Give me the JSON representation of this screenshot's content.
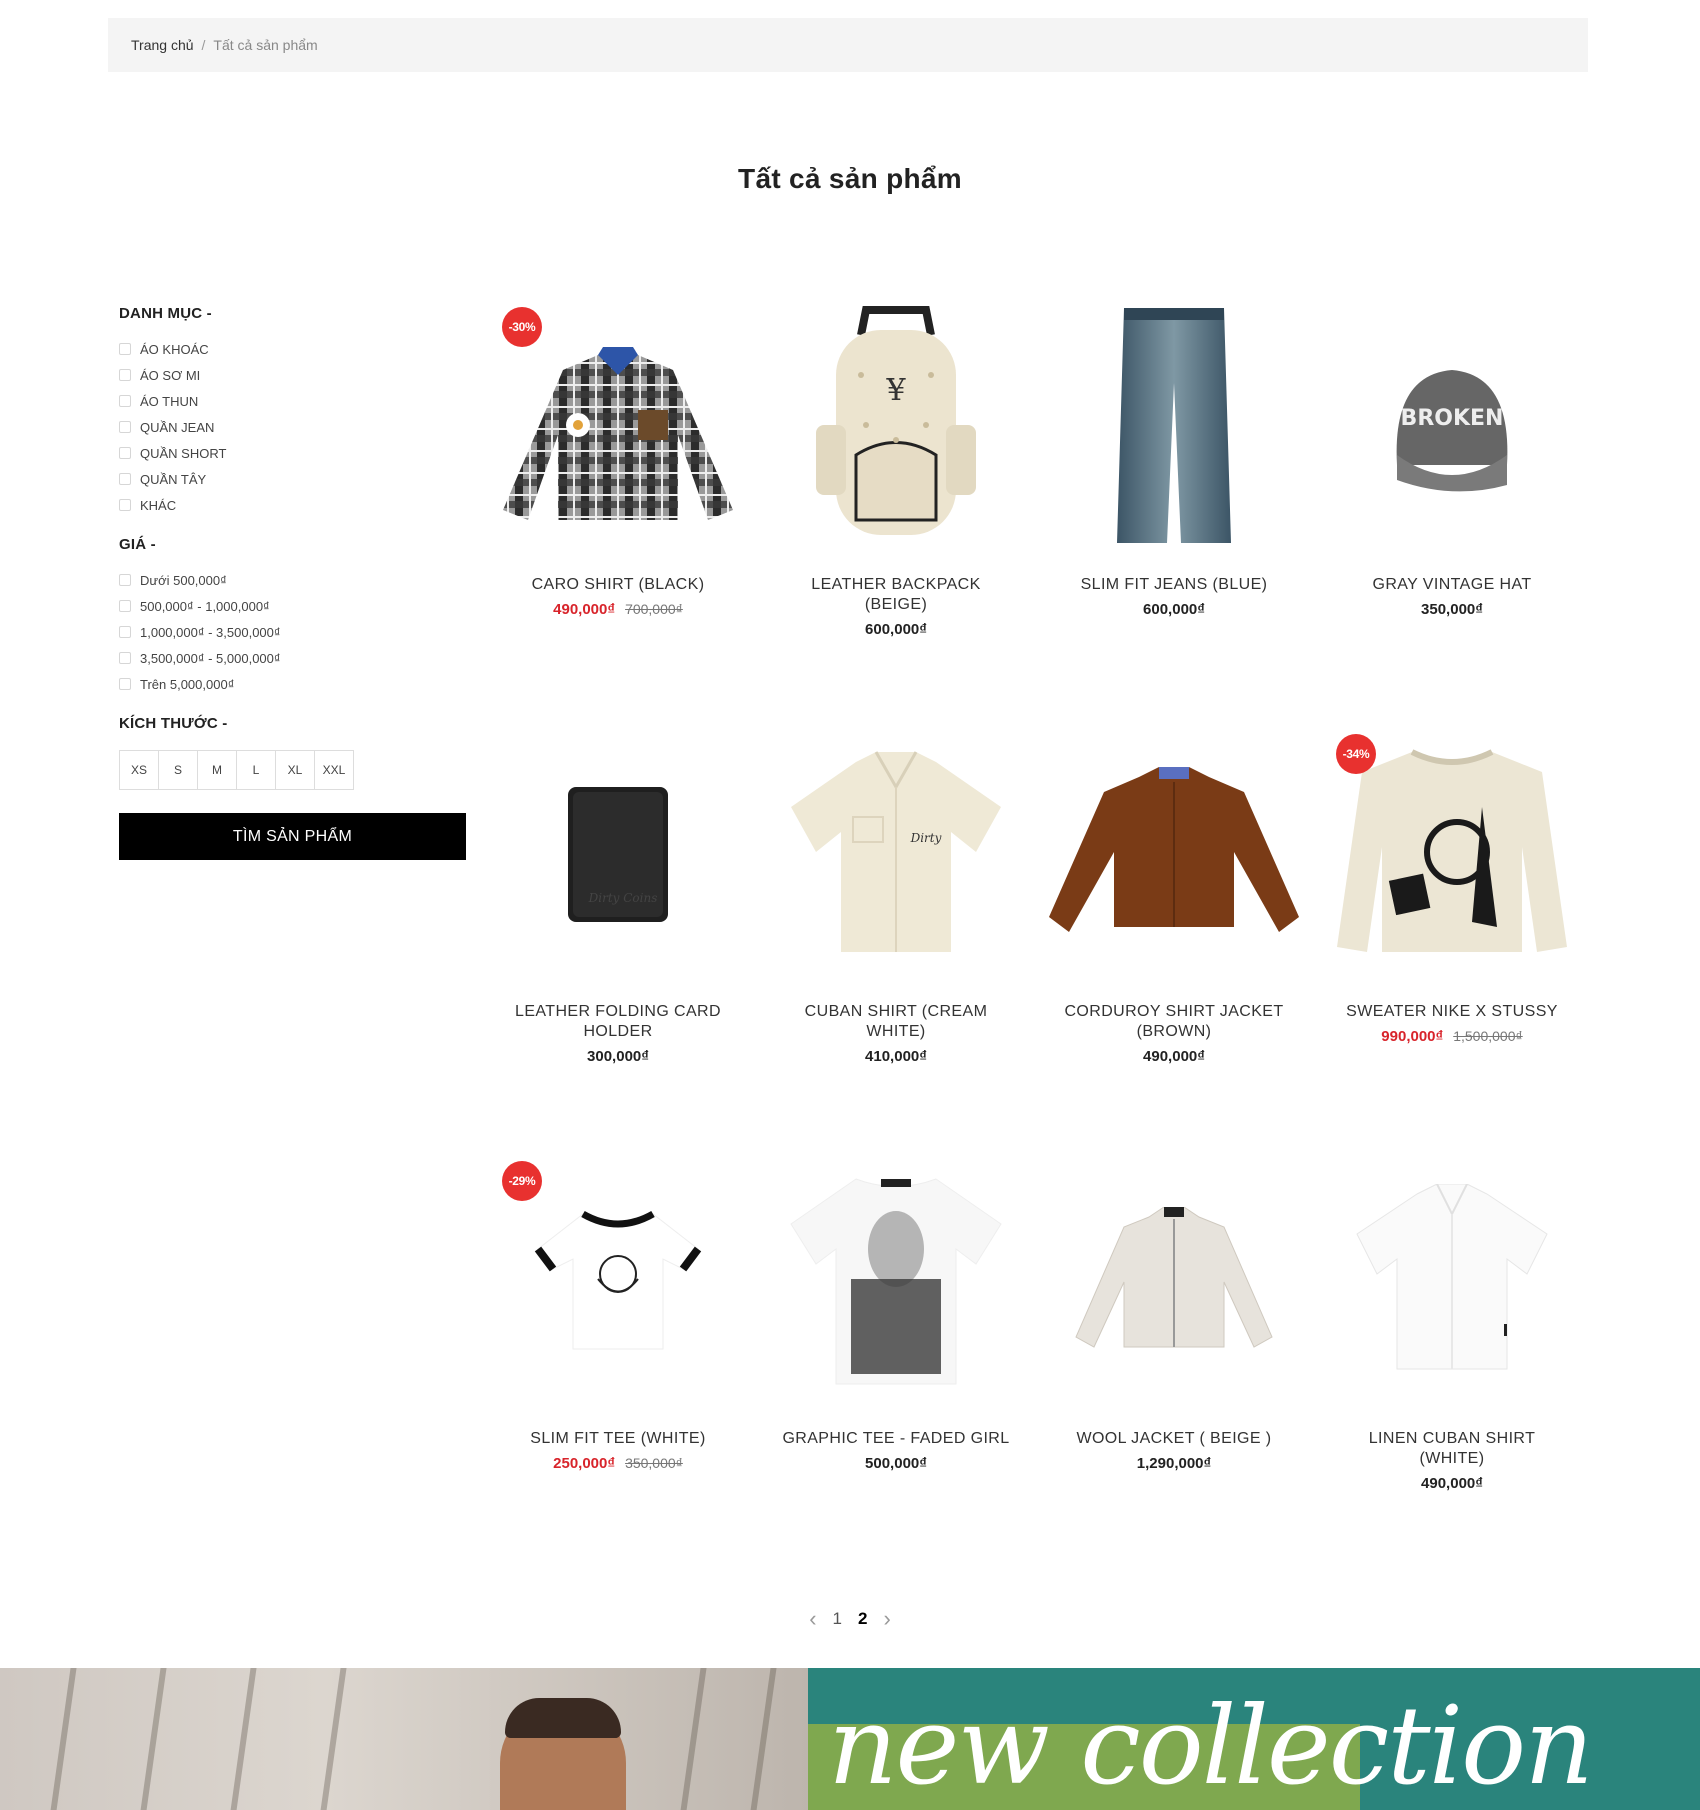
{
  "breadcrumb": {
    "home": "Trang chủ",
    "separator": "/",
    "current": "Tất cả sản phẩm"
  },
  "page_title": "Tất cả sản phẩm",
  "filters": {
    "category": {
      "heading": "DANH MỤC -",
      "options": [
        "ÁO KHOÁC",
        "ÁO SƠ MI",
        "ÁO THUN",
        "QUẦN JEAN",
        "QUẦN SHORT",
        "QUẦN TÂY",
        "KHÁC"
      ]
    },
    "price": {
      "heading": "GIÁ -",
      "options": [
        "Dưới 500,000₫",
        "500,000₫ - 1,000,000₫",
        "1,000,000₫ - 3,500,000₫",
        "3,500,000₫ - 5,000,000₫",
        "Trên 5,000,000₫"
      ]
    },
    "size": {
      "heading": "KÍCH THƯỚC -",
      "options": [
        "XS",
        "S",
        "M",
        "L",
        "XL",
        "XXL"
      ]
    },
    "search_button": "TÌM SẢN PHẨM"
  },
  "products": [
    {
      "name": "CARO SHIRT (BLACK)",
      "price": "490,000₫",
      "old_price": "700,000₫",
      "badge": "-30%",
      "icon": "plaid-shirt"
    },
    {
      "name": "LEATHER BACKPACK (BEIGE)",
      "price": "600,000₫",
      "icon": "backpack"
    },
    {
      "name": "SLIM FIT JEANS (BLUE)",
      "price": "600,000₫",
      "icon": "jeans"
    },
    {
      "name": "GRAY VINTAGE HAT",
      "price": "350,000₫",
      "icon": "cap"
    },
    {
      "name": "LEATHER FOLDING CARD HOLDER",
      "price": "300,000₫",
      "icon": "card-holder"
    },
    {
      "name": "CUBAN SHIRT (CREAM WHITE)",
      "price": "410,000₫",
      "icon": "cuban-shirt"
    },
    {
      "name": "CORDUROY SHIRT JACKET (BROWN)",
      "price": "490,000₫",
      "icon": "jacket"
    },
    {
      "name": "SWEATER NIKE X STUSSY",
      "price": "990,000₫",
      "old_price": "1,500,000₫",
      "badge": "-34%",
      "icon": "sweater"
    },
    {
      "name": "SLIM FIT TEE (WHITE)",
      "price": "250,000₫",
      "old_price": "350,000₫",
      "badge": "-29%",
      "icon": "ringer-tee"
    },
    {
      "name": "GRAPHIC TEE - FADED GIRL",
      "price": "500,000₫",
      "icon": "graphic-tee"
    },
    {
      "name": "WOOL JACKET ( BEIGE )",
      "price": "1,290,000₫",
      "icon": "wool-jacket"
    },
    {
      "name": "LINEN CUBAN SHIRT (WHITE)",
      "price": "490,000₫",
      "icon": "linen-shirt"
    }
  ],
  "pagination": {
    "prev": "‹",
    "pages": [
      "1",
      "2"
    ],
    "active": "2",
    "next": "›"
  },
  "banner": {
    "text": "new collection"
  },
  "colors": {
    "sale": "#d8242b",
    "badge": "#e8312f",
    "button": "#000000",
    "banner_teal": "#2a847c",
    "banner_green": "#7fa84f"
  }
}
